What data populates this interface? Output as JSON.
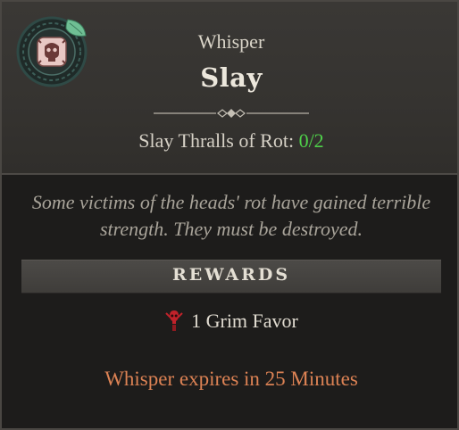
{
  "quest": {
    "type_label": "Whisper",
    "title": "Slay",
    "objective_label": "Slay Thralls of Rot:",
    "objective_progress": "0/2",
    "description": "Some victims of the heads' rot have gained terrible strength. They must be destroyed."
  },
  "rewards": {
    "header": "REWARDS",
    "items": [
      {
        "icon": "grim-favor-icon",
        "label": "1 Grim Favor"
      }
    ]
  },
  "expiry_text": "Whisper expires in 25 Minutes",
  "colors": {
    "progress": "#4fd14a",
    "expiry": "#dc8254",
    "emblem_leaf": "#6fbf94",
    "emblem_face": "#e8c8c4",
    "reward_icon": "#c0222a"
  },
  "icons": {
    "emblem": "whisper-skull-emblem-icon",
    "divider": "ornament-divider-icon"
  }
}
